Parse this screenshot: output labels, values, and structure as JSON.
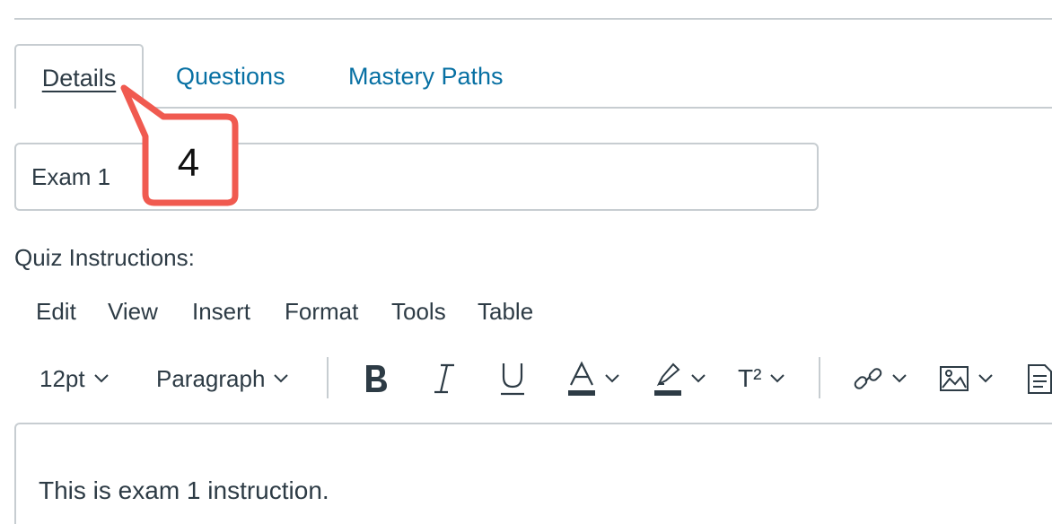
{
  "tabs": [
    {
      "label": "Details",
      "active": true
    },
    {
      "label": "Questions",
      "active": false
    },
    {
      "label": "Mastery Paths",
      "active": false
    }
  ],
  "quiz_title": {
    "value": "Exam 1"
  },
  "callout": {
    "number": "4",
    "color": "#f05a50"
  },
  "instructions_label": "Quiz Instructions:",
  "menubar": [
    "Edit",
    "View",
    "Insert",
    "Format",
    "Tools",
    "Table"
  ],
  "toolbar": {
    "font_size": "12pt",
    "block_format": "Paragraph",
    "superscript_label": "T²",
    "icons": [
      "bold-icon",
      "italic-icon",
      "underline-icon",
      "text-color-icon",
      "highlight-icon",
      "superscript-icon",
      "link-icon",
      "image-icon",
      "document-icon"
    ]
  },
  "editor": {
    "content": "This is exam 1 instruction."
  },
  "colors": {
    "link": "#0770a3",
    "text": "#2d3b45",
    "border": "#c7cdd1"
  }
}
